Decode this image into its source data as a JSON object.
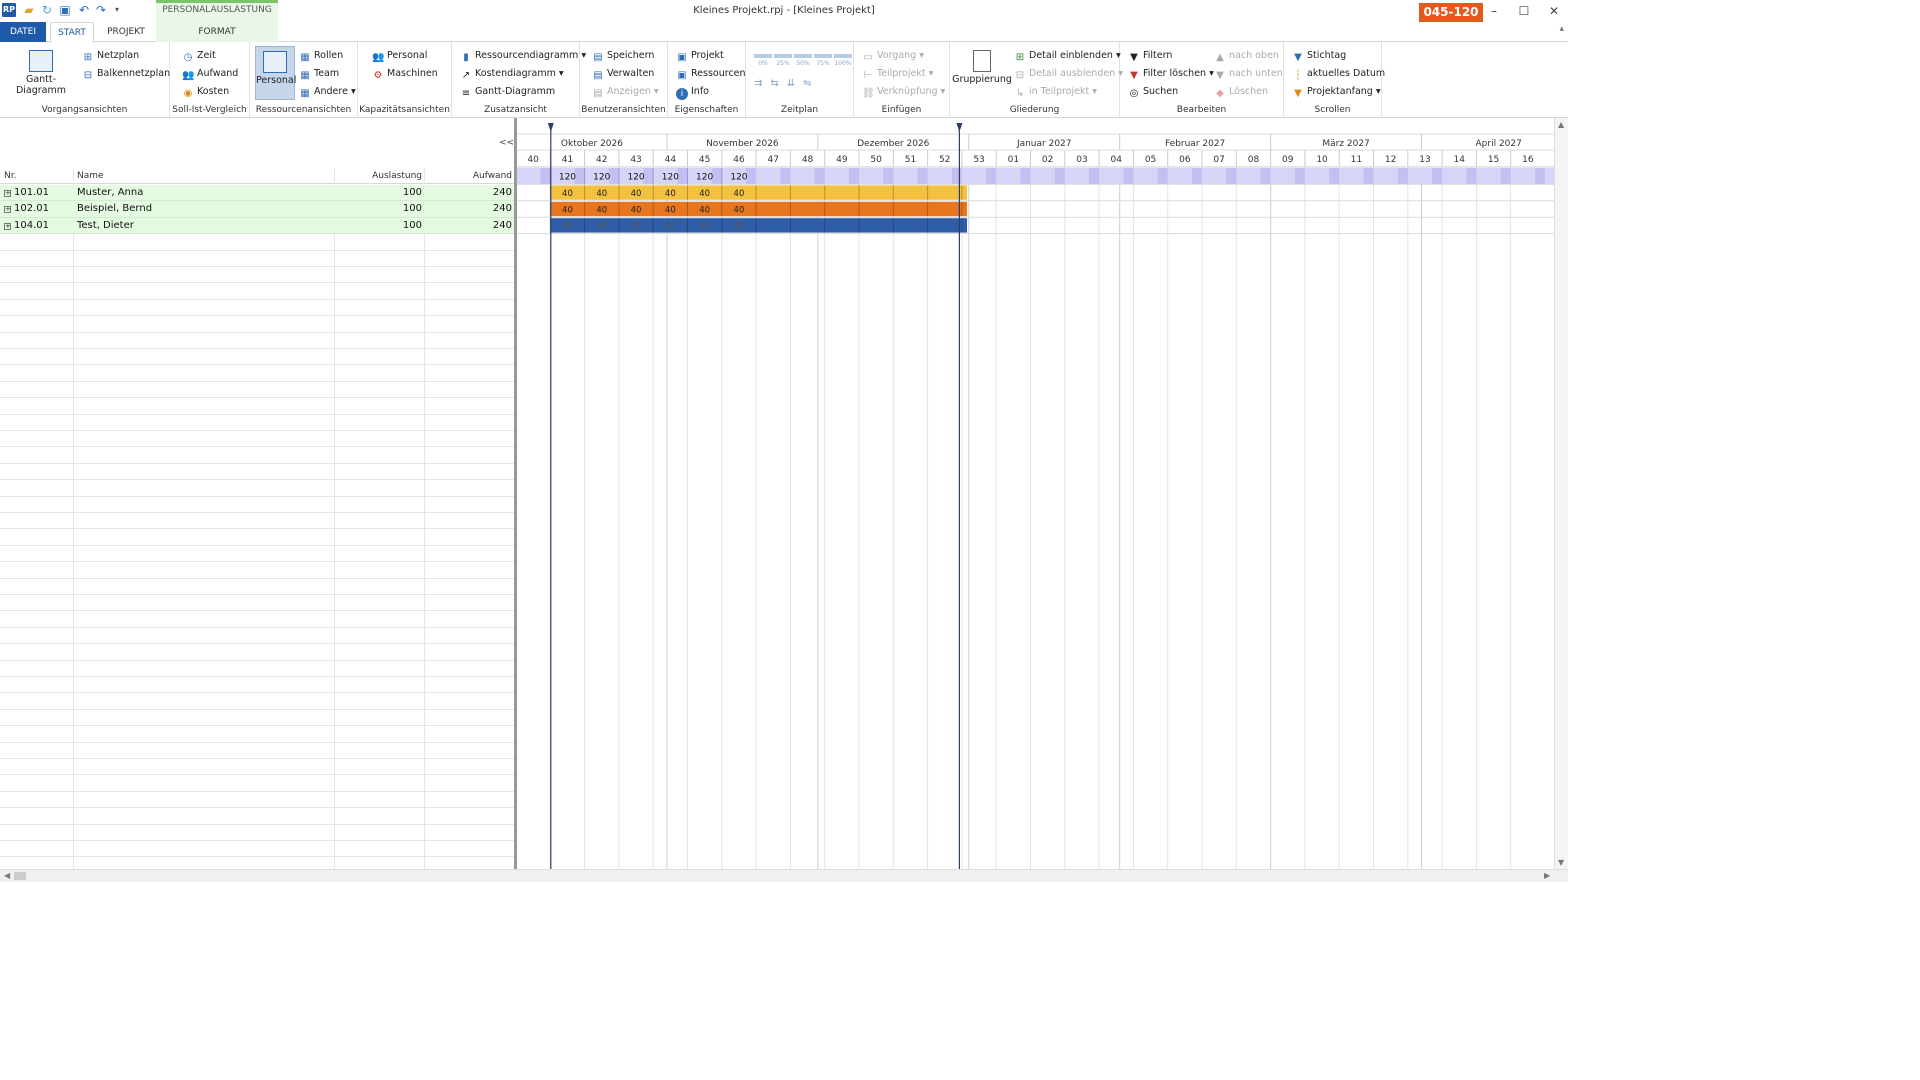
{
  "window": {
    "title": "Kleines Projekt.rpj - [Kleines Projekt]",
    "badge": "045-120",
    "logo": "RP",
    "minimize": "–",
    "maximize": "☐",
    "close": "✕"
  },
  "context_tab": "PERSONALAUSLASTUNG",
  "tabs": [
    "DATEI",
    "START",
    "PROJEKT",
    "FORMAT"
  ],
  "ribbon": {
    "vorgang": {
      "label": "Vorgangsansichten",
      "gantt": "Gantt-Diagramm",
      "netzplan": "Netzplan",
      "balken": "Balkennetzplan"
    },
    "sollist": {
      "label": "Soll-Ist-Vergleich",
      "zeit": "Zeit",
      "aufwand": "Aufwand",
      "kosten": "Kosten"
    },
    "ressourcen": {
      "label": "Ressourcenansichten",
      "personal": "Personal",
      "rollen": "Rollen",
      "team": "Team",
      "andere": "Andere"
    },
    "kapazitaet": {
      "label": "Kapazitätsansichten",
      "personal": "Personal",
      "maschinen": "Maschinen"
    },
    "zusatz": {
      "label": "Zusatzansicht",
      "rd": "Ressourcendiagramm",
      "kd": "Kostendiagramm",
      "gd": "Gantt-Diagramm"
    },
    "benutzer": {
      "label": "Benutzeransichten",
      "speichern": "Speichern",
      "verwalten": "Verwalten",
      "anzeigen": "Anzeigen"
    },
    "eigenschaften": {
      "label": "Eigenschaften",
      "projekt": "Projekt",
      "ressourcen": "Ressourcen",
      "info": "Info"
    },
    "zeitplan": {
      "label": "Zeitplan",
      "pcts": [
        "0%",
        "25%",
        "50%",
        "75%",
        "100%"
      ]
    },
    "einfuegen": {
      "label": "Einfügen",
      "vorgang": "Vorgang",
      "teilprojekt": "Teilprojekt",
      "verknuepfung": "Verknüpfung"
    },
    "gliederung": {
      "label": "Gliederung",
      "gruppierung": "Gruppierung",
      "einblenden": "Detail einblenden",
      "ausblenden": "Detail ausblenden",
      "inteil": "in Teilprojekt"
    },
    "bearbeiten": {
      "label": "Bearbeiten",
      "filtern": "Filtern",
      "filterloeschen": "Filter löschen",
      "suchen": "Suchen",
      "oben": "nach oben",
      "unten": "nach unten",
      "loeschen": "Löschen"
    },
    "scrollen": {
      "label": "Scrollen",
      "stichtag": "Stichtag",
      "aktuell": "aktuelles Datum",
      "projektanfang": "Projektanfang"
    }
  },
  "table": {
    "collapse": "<<",
    "headers": {
      "nr": "Nr.",
      "name": "Name",
      "auslastung": "Auslastung",
      "aufwand": "Aufwand"
    },
    "rows": [
      {
        "nr": "101.01",
        "name": "Muster, Anna",
        "auslastung": "100",
        "aufwand": "240",
        "color": "#f3c040"
      },
      {
        "nr": "102.01",
        "name": "Beispiel, Bernd",
        "auslastung": "100",
        "aufwand": "240",
        "color": "#e8761e"
      },
      {
        "nr": "104.01",
        "name": "Test, Dieter",
        "auslastung": "100",
        "aufwand": "240",
        "color": "#2e5ea8"
      }
    ]
  },
  "timeline": {
    "months": [
      "Oktober 2026",
      "November 2026",
      "Dezember 2026",
      "Januar 2027",
      "Februar 2027",
      "März 2027",
      "April 2027"
    ],
    "weeks": [
      "40",
      "41",
      "42",
      "43",
      "44",
      "45",
      "46",
      "47",
      "48",
      "49",
      "50",
      "51",
      "52",
      "53",
      "01",
      "02",
      "03",
      "04",
      "05",
      "06",
      "07",
      "08",
      "09",
      "10",
      "11",
      "12",
      "13",
      "14",
      "15",
      "16"
    ],
    "summary_values": [
      "120",
      "120",
      "120",
      "120",
      "120",
      "120"
    ],
    "resource_values": [
      "40",
      "40",
      "40",
      "40",
      "40",
      "40"
    ],
    "summary_color": "#d6d4f7",
    "summary_stripe": "#c3bff2"
  }
}
